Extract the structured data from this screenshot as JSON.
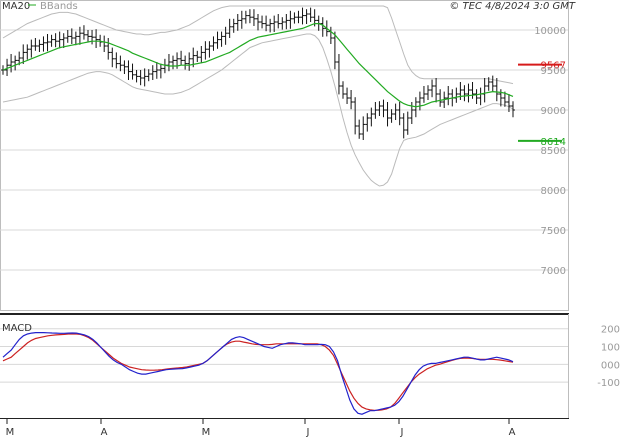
{
  "header": {
    "legend_ma": "MA20",
    "legend_bb": "BBands",
    "copyright": "© TEC 4/8/2024 3:0 GMT"
  },
  "colors": {
    "ma": "#22aa22",
    "bbands": "#bbbbbb",
    "price": "#111111",
    "resistance": "#d61a1a",
    "support": "#22aa22",
    "macd_line": "#2222cc",
    "signal_line": "#cc2222",
    "grid": "#d8d8d8"
  },
  "chart_data": [
    {
      "type": "ohlc",
      "ylim": [
        6500,
        10300
      ],
      "y_ticks": [
        7000,
        7500,
        8000,
        8500,
        9000,
        9500,
        10000
      ],
      "y_tick_labels": [
        "7000",
        "7500",
        "8000",
        "8500",
        "9000",
        "9500",
        "10000"
      ],
      "x_ticks": [
        "M",
        "A",
        "M",
        "J",
        "J",
        "A"
      ],
      "levels": [
        {
          "name": "resistance",
          "value": 9567,
          "label": "9567"
        },
        {
          "name": "support",
          "value": 8614,
          "label": "8614"
        }
      ],
      "close": [
        9500,
        9560,
        9600,
        9620,
        9650,
        9720,
        9760,
        9800,
        9800,
        9820,
        9840,
        9850,
        9880,
        9860,
        9880,
        9900,
        9920,
        9900,
        9920,
        9960,
        9940,
        9920,
        9910,
        9880,
        9850,
        9800,
        9720,
        9640,
        9580,
        9560,
        9540,
        9480,
        9440,
        9420,
        9400,
        9420,
        9450,
        9480,
        9500,
        9520,
        9560,
        9600,
        9620,
        9640,
        9620,
        9580,
        9640,
        9680,
        9660,
        9720,
        9760,
        9800,
        9840,
        9880,
        9920,
        9960,
        10040,
        10080,
        10120,
        10140,
        10180,
        10160,
        10140,
        10100,
        10080,
        10060,
        10080,
        10100,
        10080,
        10100,
        10120,
        10140,
        10160,
        10160,
        10180,
        10200,
        10160,
        10120,
        10080,
        10020,
        9980,
        9900,
        9600,
        9300,
        9200,
        9150,
        9100,
        8800,
        8700,
        8820,
        8900,
        8950,
        9000,
        9050,
        9000,
        8900,
        8950,
        9000,
        8900,
        8750,
        8900,
        9000,
        9100,
        9150,
        9200,
        9250,
        9300,
        9200,
        9100,
        9150,
        9200,
        9150,
        9200,
        9250,
        9200,
        9250,
        9200,
        9150,
        9200,
        9300,
        9350,
        9300,
        9200,
        9150,
        9100,
        9050,
        9000
      ],
      "ma20": [
        9500,
        9520,
        9540,
        9560,
        9580,
        9600,
        9620,
        9640,
        9660,
        9680,
        9700,
        9720,
        9740,
        9760,
        9780,
        9790,
        9800,
        9810,
        9820,
        9830,
        9840,
        9850,
        9860,
        9860,
        9860,
        9850,
        9840,
        9820,
        9800,
        9780,
        9760,
        9740,
        9710,
        9690,
        9670,
        9650,
        9630,
        9610,
        9590,
        9570,
        9560,
        9550,
        9550,
        9550,
        9560,
        9560,
        9560,
        9570,
        9580,
        9590,
        9600,
        9620,
        9640,
        9660,
        9680,
        9700,
        9720,
        9750,
        9780,
        9810,
        9840,
        9870,
        9890,
        9910,
        9920,
        9930,
        9940,
        9950,
        9960,
        9970,
        9980,
        9990,
        10000,
        10010,
        10020,
        10040,
        10060,
        10080,
        10080,
        10060,
        10020,
        9980,
        9940,
        9880,
        9820,
        9760,
        9700,
        9640,
        9580,
        9530,
        9480,
        9430,
        9380,
        9330,
        9280,
        9230,
        9190,
        9150,
        9110,
        9080,
        9060,
        9050,
        9040,
        9050,
        9060,
        9080,
        9100,
        9110,
        9120,
        9130,
        9140,
        9150,
        9160,
        9170,
        9175,
        9180,
        9185,
        9190,
        9200,
        9210,
        9220,
        9230,
        9225,
        9220,
        9210,
        9190,
        9170
      ],
      "bb_upper": [
        9900,
        9930,
        9960,
        9990,
        10020,
        10050,
        10080,
        10100,
        10120,
        10140,
        10160,
        10180,
        10200,
        10210,
        10220,
        10220,
        10220,
        10210,
        10200,
        10180,
        10160,
        10140,
        10120,
        10100,
        10080,
        10060,
        10040,
        10020,
        10000,
        9990,
        9980,
        9970,
        9960,
        9950,
        9950,
        9940,
        9940,
        9950,
        9960,
        9970,
        9970,
        9980,
        9990,
        10000,
        10020,
        10040,
        10060,
        10090,
        10120,
        10150,
        10180,
        10210,
        10240,
        10260,
        10280,
        10290,
        10300,
        10300,
        10300,
        10300,
        10300,
        10300,
        10300,
        10300,
        10300,
        10300,
        10300,
        10300,
        10300,
        10300,
        10300,
        10300,
        10300,
        10300,
        10300,
        10300,
        10300,
        10300,
        10300,
        10300,
        10300,
        10300,
        10300,
        10300,
        10300,
        10300,
        10300,
        10300,
        10300,
        10300,
        10300,
        10300,
        10300,
        10300,
        10300,
        10280,
        10150,
        10000,
        9850,
        9700,
        9560,
        9480,
        9430,
        9400,
        9390,
        9390,
        9390,
        9390,
        9390,
        9390,
        9390,
        9390,
        9390,
        9390,
        9390,
        9390,
        9390,
        9390,
        9390,
        9390,
        9390,
        9380,
        9370,
        9360,
        9350,
        9340,
        9330
      ],
      "bb_lower": [
        9100,
        9110,
        9120,
        9130,
        9140,
        9150,
        9160,
        9180,
        9200,
        9220,
        9240,
        9260,
        9280,
        9300,
        9320,
        9340,
        9360,
        9380,
        9400,
        9420,
        9440,
        9460,
        9470,
        9480,
        9480,
        9470,
        9460,
        9440,
        9410,
        9380,
        9350,
        9320,
        9290,
        9270,
        9260,
        9250,
        9240,
        9230,
        9220,
        9210,
        9200,
        9200,
        9200,
        9210,
        9220,
        9240,
        9260,
        9290,
        9320,
        9350,
        9380,
        9410,
        9440,
        9470,
        9500,
        9540,
        9580,
        9620,
        9660,
        9700,
        9740,
        9780,
        9800,
        9820,
        9840,
        9850,
        9860,
        9870,
        9880,
        9890,
        9900,
        9910,
        9920,
        9930,
        9940,
        9950,
        9950,
        9930,
        9880,
        9780,
        9640,
        9480,
        9300,
        9100,
        8900,
        8720,
        8560,
        8440,
        8340,
        8250,
        8180,
        8120,
        8080,
        8050,
        8060,
        8100,
        8200,
        8360,
        8520,
        8620,
        8640,
        8650,
        8660,
        8680,
        8700,
        8730,
        8760,
        8790,
        8820,
        8840,
        8860,
        8880,
        8900,
        8920,
        8940,
        8960,
        8980,
        9000,
        9020,
        9040,
        9060,
        9080,
        9080,
        9070,
        9060,
        9040,
        9010
      ]
    },
    {
      "type": "line",
      "title": "MACD",
      "ylim": [
        -290,
        260
      ],
      "y_ticks": [
        200,
        100,
        0,
        -100
      ],
      "y_tick_labels": [
        "200",
        "100",
        "000",
        "-100"
      ],
      "series": [
        {
          "name": "macd",
          "values": [
            40,
            60,
            80,
            110,
            140,
            160,
            170,
            175,
            178,
            178,
            178,
            177,
            176,
            175,
            174,
            174,
            175,
            176,
            175,
            170,
            165,
            155,
            140,
            120,
            95,
            70,
            45,
            25,
            10,
            0,
            -15,
            -30,
            -40,
            -50,
            -55,
            -55,
            -50,
            -45,
            -40,
            -35,
            -30,
            -28,
            -26,
            -25,
            -24,
            -20,
            -15,
            -10,
            -5,
            5,
            20,
            40,
            60,
            80,
            100,
            120,
            140,
            150,
            155,
            150,
            140,
            130,
            120,
            110,
            100,
            95,
            90,
            100,
            110,
            115,
            120,
            120,
            118,
            115,
            110,
            110,
            110,
            110,
            112,
            110,
            100,
            70,
            20,
            -60,
            -130,
            -200,
            -250,
            -275,
            -280,
            -270,
            -260,
            -260,
            -255,
            -250,
            -245,
            -240,
            -230,
            -210,
            -180,
            -140,
            -100,
            -60,
            -30,
            -10,
            0,
            5,
            5,
            10,
            15,
            20,
            25,
            30,
            35,
            40,
            40,
            35,
            30,
            25,
            25,
            30,
            35,
            40,
            35,
            30,
            25,
            15
          ]
        },
        {
          "name": "signal",
          "values": [
            20,
            30,
            40,
            60,
            80,
            100,
            120,
            135,
            145,
            150,
            155,
            160,
            163,
            165,
            167,
            168,
            170,
            171,
            170,
            168,
            160,
            150,
            135,
            115,
            95,
            75,
            55,
            35,
            20,
            5,
            -5,
            -15,
            -20,
            -25,
            -30,
            -32,
            -33,
            -33,
            -32,
            -30,
            -27,
            -24,
            -22,
            -20,
            -18,
            -15,
            -10,
            -5,
            0,
            5,
            20,
            40,
            60,
            80,
            100,
            115,
            125,
            130,
            130,
            125,
            120,
            115,
            112,
            110,
            110,
            110,
            112,
            115,
            115,
            115,
            115,
            115,
            115,
            115,
            115,
            115,
            115,
            115,
            110,
            100,
            80,
            50,
            0,
            -50,
            -100,
            -150,
            -190,
            -220,
            -240,
            -250,
            -255,
            -258,
            -258,
            -255,
            -250,
            -240,
            -220,
            -190,
            -160,
            -130,
            -100,
            -75,
            -55,
            -40,
            -25,
            -15,
            -5,
            0,
            8,
            15,
            22,
            28,
            33,
            35,
            35,
            33,
            30,
            28,
            28,
            28,
            28,
            26,
            24,
            20,
            16,
            12
          ]
        }
      ]
    }
  ]
}
